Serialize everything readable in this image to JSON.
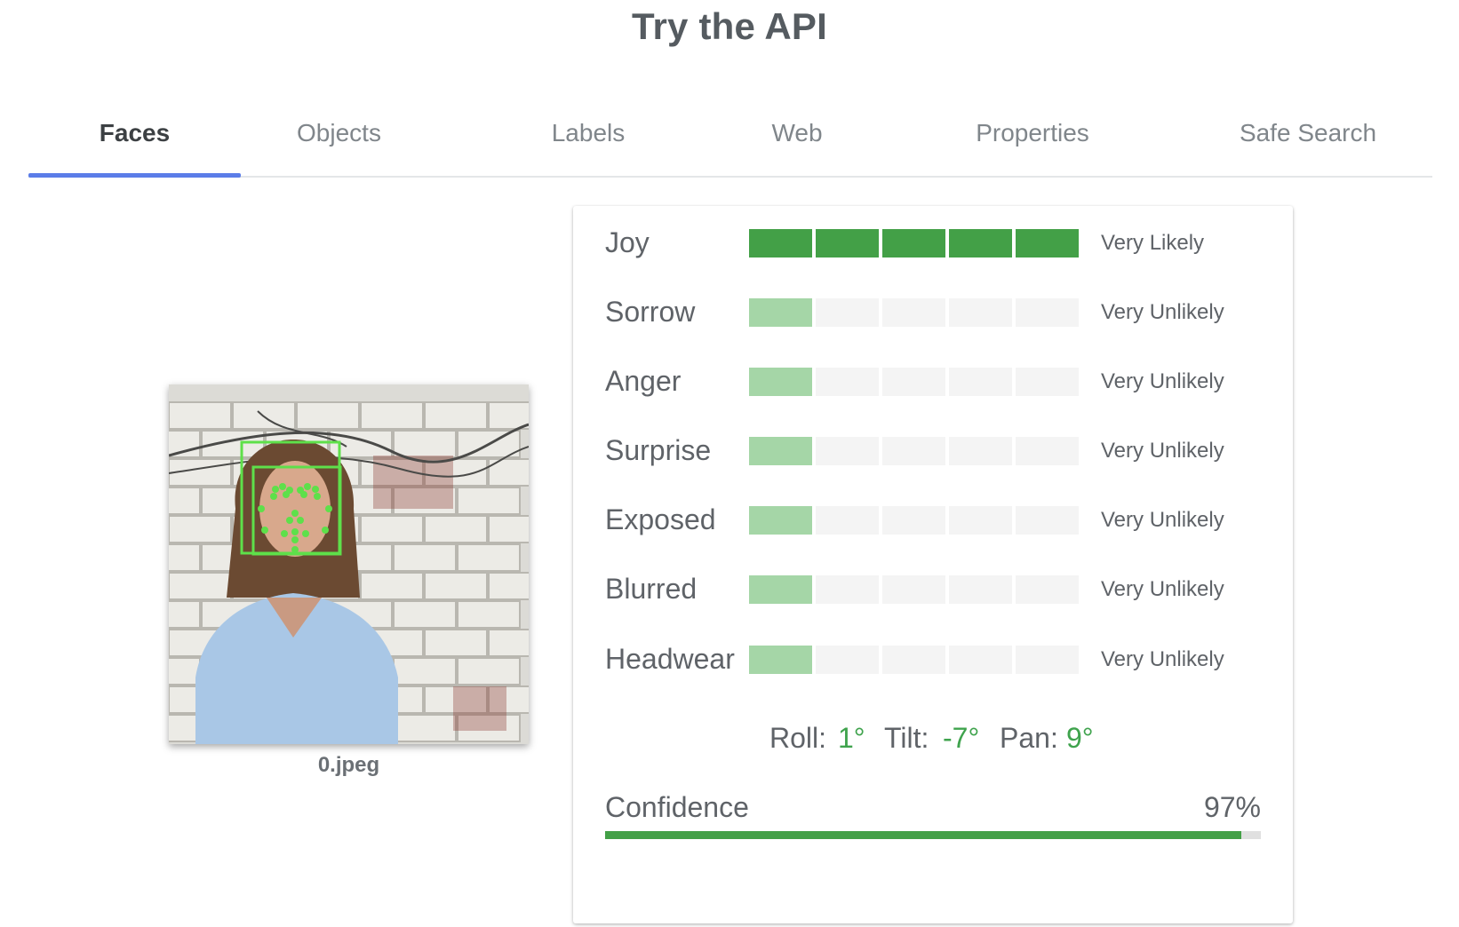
{
  "page": {
    "title": "Try the API"
  },
  "tabs": [
    {
      "label": "Faces",
      "active": true
    },
    {
      "label": "Objects",
      "active": false
    },
    {
      "label": "Labels",
      "active": false
    },
    {
      "label": "Web",
      "active": false
    },
    {
      "label": "Properties",
      "active": false
    },
    {
      "label": "Safe Search",
      "active": false
    }
  ],
  "preview": {
    "filename": "0.jpeg"
  },
  "likelihood_scale_steps": 5,
  "attributes": [
    {
      "label": "Joy",
      "level": 5,
      "value": "Very Likely"
    },
    {
      "label": "Sorrow",
      "level": 1,
      "value": "Very Unlikely"
    },
    {
      "label": "Anger",
      "level": 1,
      "value": "Very Unlikely"
    },
    {
      "label": "Surprise",
      "level": 1,
      "value": "Very Unlikely"
    },
    {
      "label": "Exposed",
      "level": 1,
      "value": "Very Unlikely"
    },
    {
      "label": "Blurred",
      "level": 1,
      "value": "Very Unlikely"
    },
    {
      "label": "Headwear",
      "level": 1,
      "value": "Very Unlikely"
    }
  ],
  "angles": {
    "roll_label": "Roll:",
    "roll_value": "1°",
    "tilt_label": "Tilt:",
    "tilt_value": "-7°",
    "pan_label": "Pan:",
    "pan_value": "9°"
  },
  "confidence": {
    "label": "Confidence",
    "value": "97%",
    "fraction": 0.97
  },
  "colors": {
    "tab_indicator": "#5b7de8",
    "bar_strong": "#43a047",
    "bar_weak": "#a5d6a7",
    "bar_empty": "#f4f4f4",
    "angle_value": "#3fa34d",
    "face_overlay": "#5ee04a"
  }
}
